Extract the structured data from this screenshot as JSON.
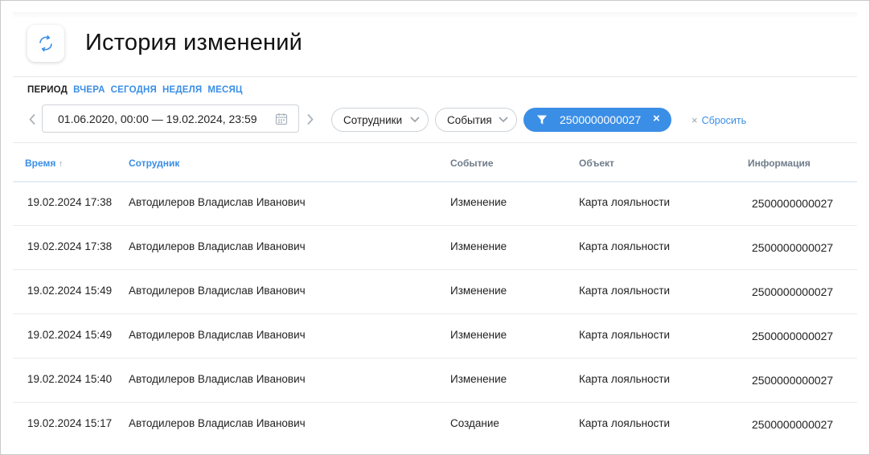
{
  "header": {
    "title": "История изменений",
    "icon": "refresh-icon"
  },
  "period": {
    "label": "ПЕРИОД",
    "options": [
      "ВЧЕРА",
      "СЕГОДНЯ",
      "НЕДЕЛЯ",
      "МЕСЯЦ"
    ]
  },
  "filters": {
    "date_range": "01.06.2020, 00:00 — 19.02.2024, 23:59",
    "employees_label": "Сотрудники",
    "events_label": "События",
    "active_filter": "2500000000027",
    "active_filter_remove": "×",
    "reset_x": "×",
    "reset_label": "Сбросить"
  },
  "colors": {
    "accent": "#3b8ee6",
    "header_text": "#6f7c8a"
  },
  "table": {
    "columns": {
      "time": "Время",
      "sort_arrow": "↑",
      "employee": "Сотрудник",
      "event": "Событие",
      "object": "Объект",
      "info": "Информация"
    },
    "rows": [
      {
        "time": "19.02.2024 17:38",
        "employee": "Автодилеров Владислав Иванович",
        "event": "Изменение",
        "object": "Карта лояльности",
        "info": "2500000000027"
      },
      {
        "time": "19.02.2024 17:38",
        "employee": "Автодилеров Владислав Иванович",
        "event": "Изменение",
        "object": "Карта лояльности",
        "info": "2500000000027"
      },
      {
        "time": "19.02.2024 15:49",
        "employee": "Автодилеров Владислав Иванович",
        "event": "Изменение",
        "object": "Карта лояльности",
        "info": "2500000000027"
      },
      {
        "time": "19.02.2024 15:49",
        "employee": "Автодилеров Владислав Иванович",
        "event": "Изменение",
        "object": "Карта лояльности",
        "info": "2500000000027"
      },
      {
        "time": "19.02.2024 15:40",
        "employee": "Автодилеров Владислав Иванович",
        "event": "Изменение",
        "object": "Карта лояльности",
        "info": "2500000000027"
      },
      {
        "time": "19.02.2024 15:17",
        "employee": "Автодилеров Владислав Иванович",
        "event": "Создание",
        "object": "Карта лояльности",
        "info": "2500000000027"
      }
    ]
  }
}
